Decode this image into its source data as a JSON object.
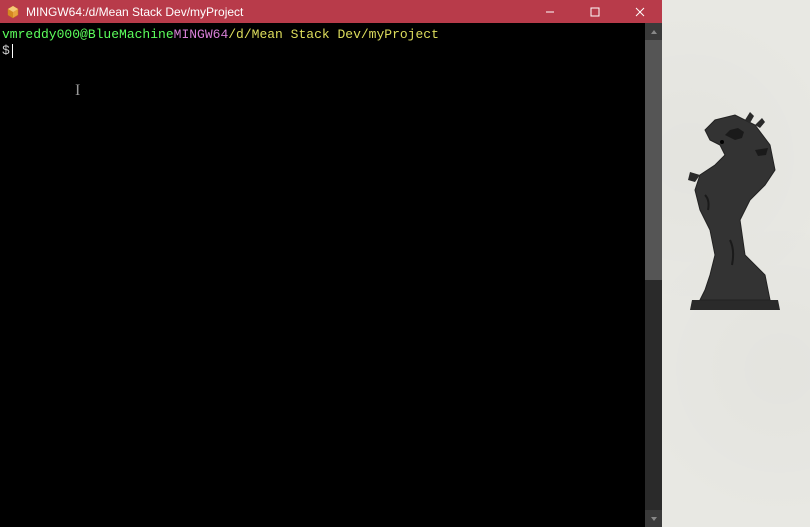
{
  "window": {
    "title": "MINGW64:/d/Mean Stack Dev/myProject"
  },
  "terminal": {
    "prompt_user": "vmreddy000@BlueMachine",
    "prompt_env": "MINGW64",
    "prompt_path": "/d/Mean Stack Dev/myProject",
    "prompt_symbol": "$",
    "space": " "
  },
  "colors": {
    "titlebar": "#b83b4a",
    "user": "#5cff5c",
    "env": "#d67fd6",
    "path": "#dddd5c"
  }
}
